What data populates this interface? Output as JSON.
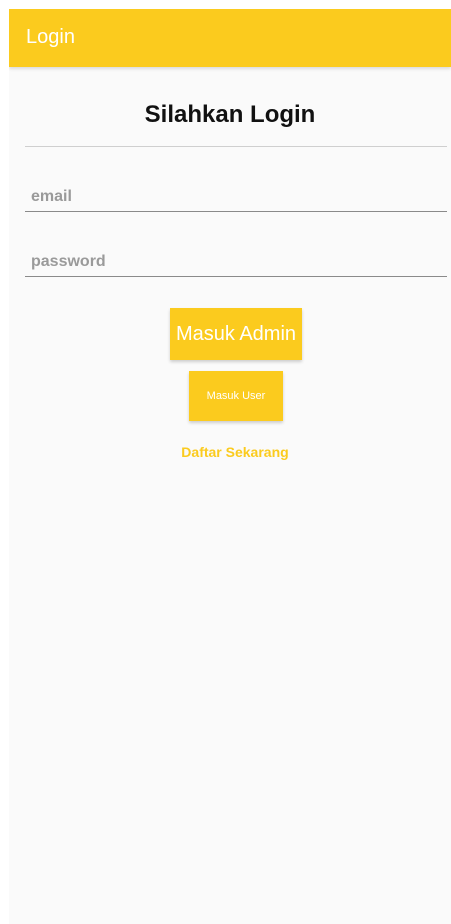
{
  "app_bar": {
    "title": "Login",
    "color": "#fbcb1e"
  },
  "form": {
    "heading": "Silahkan Login",
    "email_placeholder": "email",
    "email_value": "",
    "password_placeholder": "password",
    "password_value": ""
  },
  "buttons": {
    "admin_label": "Masuk Admin",
    "user_label": "Masuk User"
  },
  "links": {
    "register_label": "Daftar Sekarang"
  }
}
